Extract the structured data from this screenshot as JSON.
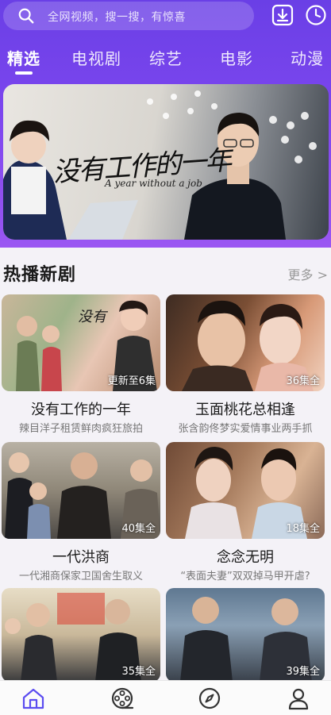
{
  "search": {
    "placeholder": "全网视频，搜一搜，有惊喜"
  },
  "icons": {
    "search": "search-icon",
    "download": "download-icon",
    "history": "history-clock-icon",
    "nav": [
      "home-icon",
      "film-reel-icon",
      "discover-compass-icon",
      "profile-icon"
    ]
  },
  "tabs": [
    {
      "label": "精选",
      "active": true
    },
    {
      "label": "电视剧",
      "active": false
    },
    {
      "label": "综艺",
      "active": false
    },
    {
      "label": "电影",
      "active": false
    },
    {
      "label": "动漫",
      "active": false
    }
  ],
  "banner": {
    "title": "没有工作的一年",
    "subtitle": "A year without a job"
  },
  "section": {
    "title": "热播新剧",
    "more": "更多 >"
  },
  "cards": [
    {
      "name": "没有工作的一年",
      "desc": "辣目洋子租赁鲜肉疯狂旅拍",
      "badge": "更新至6集"
    },
    {
      "name": "玉面桃花总相逢",
      "desc": "张含韵佟梦实爱情事业两手抓",
      "badge": "36集全"
    },
    {
      "name": "一代洪商",
      "desc": "一代湘商保家卫国舍生取义",
      "badge": "40集全"
    },
    {
      "name": "念念无明",
      "desc": "“表面夫妻”双双掉马甲开虐?",
      "badge": "18集全"
    },
    {
      "name": "",
      "desc": "",
      "badge": "35集全"
    },
    {
      "name": "",
      "desc": "",
      "badge": "39集全"
    }
  ],
  "colors": {
    "accent": "#7c46ee",
    "nav_active": "#5b4cf0"
  }
}
